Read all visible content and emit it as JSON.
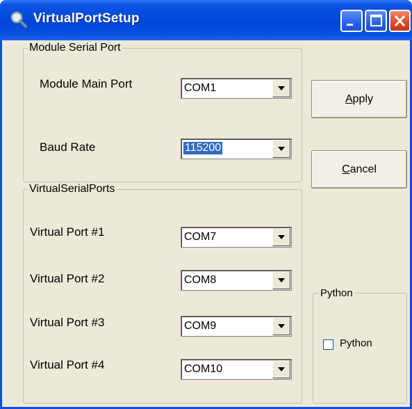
{
  "window": {
    "title": "VirtualPortSetup"
  },
  "module_group": {
    "label": "Module Serial Port",
    "main_port": {
      "label": "Module Main Port",
      "value": "COM1"
    },
    "baud_rate": {
      "label": "Baud Rate",
      "value": "115200"
    }
  },
  "virtual_group": {
    "label": "VirtualSerialPorts",
    "ports": [
      {
        "label": "Virtual Port #1",
        "value": "COM7"
      },
      {
        "label": "Virtual Port #2",
        "value": "COM8"
      },
      {
        "label": "Virtual Port #3",
        "value": "COM9"
      },
      {
        "label": "Virtual Port #4",
        "value": "COM10"
      }
    ]
  },
  "buttons": {
    "apply": {
      "mnemonic": "A",
      "rest": "pply"
    },
    "cancel": {
      "mnemonic": "C",
      "rest": "ancel"
    }
  },
  "python_group": {
    "label": "Python",
    "checkbox_label": "Python",
    "checked": false
  }
}
